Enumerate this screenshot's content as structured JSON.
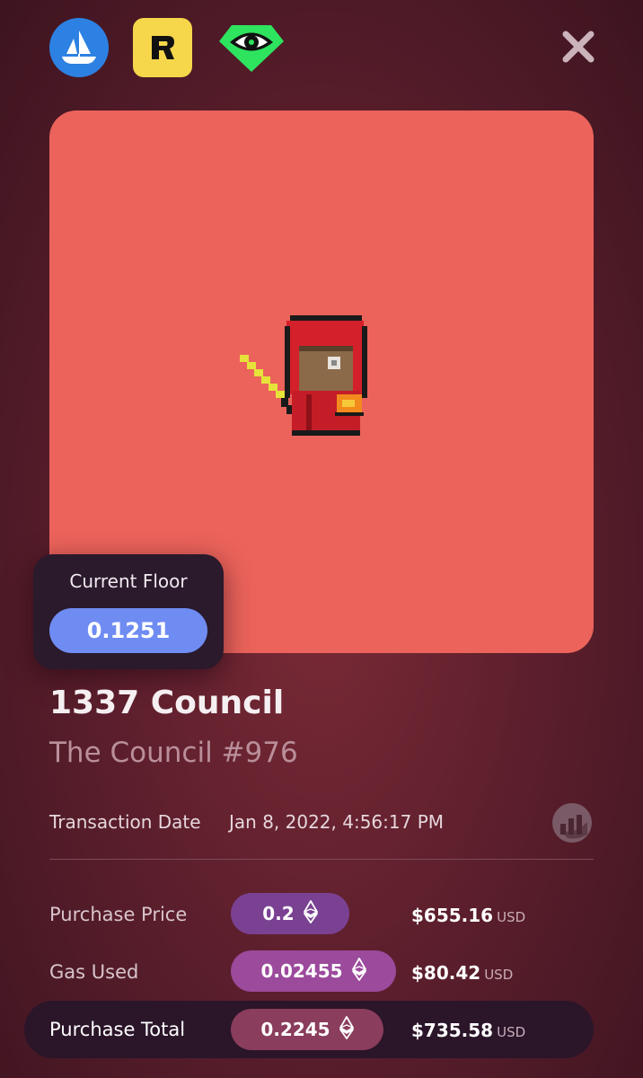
{
  "icons": {
    "opensea": "opensea-ship-icon",
    "rarible": "rarible-r-icon",
    "looksrare": "looksrare-eye-icon",
    "close": "close-icon",
    "chart": "chart-icon",
    "eth": "ethereum-icon"
  },
  "floor": {
    "label": "Current Floor",
    "value": "0.1251"
  },
  "nft": {
    "collection": "1337 Council",
    "name": "The Council #976"
  },
  "transaction": {
    "label": "Transaction Date",
    "value": "Jan 8, 2022, 4:56:17 PM"
  },
  "rows": [
    {
      "label": "Purchase Price",
      "eth": "0.2",
      "usd": "$655.16",
      "unit": "USD"
    },
    {
      "label": "Gas Used",
      "eth": "0.02455",
      "usd": "$80.42",
      "unit": "USD"
    },
    {
      "label": "Purchase Total",
      "eth": "0.2245",
      "usd": "$735.58",
      "unit": "USD"
    }
  ],
  "colors": {
    "background": "#5e1f2d",
    "art_background": "#eb635b",
    "floor_pill": "#6f8cf3",
    "price_pill": "#7a4193",
    "gas_pill": "#9b4a9c",
    "total_pill": "#8a3d5c"
  }
}
